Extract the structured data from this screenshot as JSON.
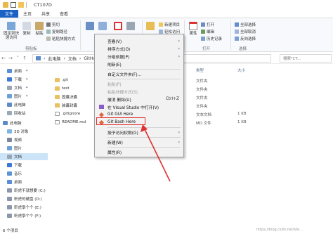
{
  "window": {
    "title": "CT107D"
  },
  "tabs": [
    "文件",
    "主页",
    "共享",
    "查看"
  ],
  "ribbon": {
    "pin_label": "固定到快速访问",
    "copy_label": "复制",
    "paste_label": "粘贴",
    "cut_label": "剪切",
    "copy_path_label": "复制路径",
    "paste_shortcut_label": "粘贴快捷方式",
    "new_item_label": "新建项目",
    "easy_access_label": "轻松访问",
    "properties_label": "属性",
    "open_label": "打开",
    "edit_label": "编辑",
    "history_label": "历史记录",
    "select_all_label": "全部选择",
    "select_none_label": "全部取消",
    "invert_label": "反向选择",
    "clipboard_group": "剪贴板",
    "open_group": "打开",
    "select_group": "选择"
  },
  "address": {
    "crumbs": [
      "此电脑",
      "文档",
      "GitHu"
    ],
    "search_placeholder": "搜索\"CT..."
  },
  "nav": {
    "items": [
      "桌面",
      "下载",
      "文档",
      "图片",
      "此电脑",
      "回收站",
      "此电脑",
      "3D 对象",
      "视频",
      "图片",
      "文档",
      "下载",
      "音乐",
      "桌面",
      "軒虎不就想要 (C:)",
      "軒虎的硬盘 (D:)",
      "軒虎學个个 (E:)",
      "軒虎學个个 (F:)"
    ]
  },
  "files": {
    "headers": {
      "type": "类型",
      "size": "大小"
    },
    "rows": [
      {
        "name": ".git",
        "type": "文件夹",
        "size": ""
      },
      {
        "name": "test",
        "type": "文件夹",
        "size": ""
      },
      {
        "name": "固囊决囊",
        "type": "文件夹",
        "size": ""
      },
      {
        "name": "装囊封囊",
        "type": "文件夹",
        "size": ""
      },
      {
        "name": ".gitignore",
        "type": "文本文档",
        "size": "1 KB"
      },
      {
        "name": "README.md",
        "type": "MD 文件",
        "size": "1 KB"
      }
    ]
  },
  "context_menu": {
    "items": [
      {
        "label": "查看(V)",
        "submenu": true,
        "disabled": false
      },
      {
        "label": "排序方式(O)",
        "submenu": true,
        "disabled": false
      },
      {
        "label": "分组依据(P)",
        "submenu": true,
        "disabled": false
      },
      {
        "label": "刷新(E)",
        "submenu": false,
        "disabled": false
      },
      {
        "label": "自定义文件夹(F)...",
        "submenu": false,
        "disabled": false
      },
      {
        "label": "粘贴(P)",
        "submenu": false,
        "disabled": true
      },
      {
        "label": "粘贴快捷方式(S)",
        "submenu": false,
        "disabled": true
      },
      {
        "label": "撤消 删除(U)",
        "shortcut": "Ctrl+Z",
        "submenu": false,
        "disabled": false
      },
      {
        "label": "在 Visual Studio 中打开(V)",
        "submenu": false,
        "disabled": false
      },
      {
        "label": "Git GUI Here",
        "submenu": false,
        "disabled": false
      },
      {
        "label": "Git Bash Here",
        "submenu": false,
        "disabled": false
      },
      {
        "label": "授予访问权限(G)",
        "submenu": true,
        "disabled": false
      },
      {
        "label": "新建(W)",
        "submenu": true,
        "disabled": false
      },
      {
        "label": "属性(R)",
        "submenu": false,
        "disabled": false
      }
    ]
  },
  "status": {
    "count": "6 个项目"
  },
  "watermark": "https://blog.csdn.net/Vie..."
}
